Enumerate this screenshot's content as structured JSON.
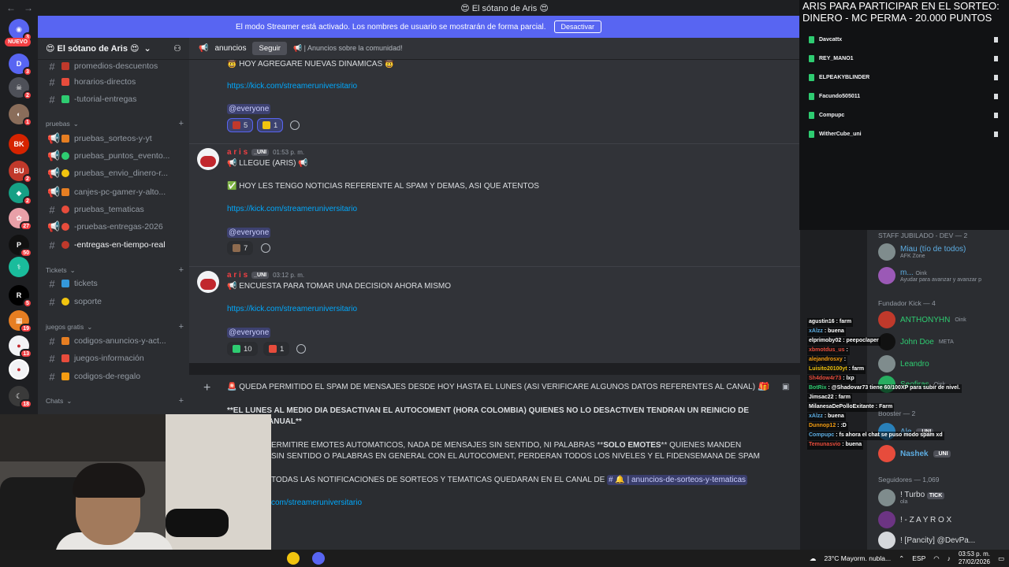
{
  "titlebar": {
    "title": "😍 El sótano de Aris 😍"
  },
  "rail": {
    "nuevo_label": "NUEVO",
    "badges": [
      "3",
      "3",
      "2",
      "1",
      "2",
      "2",
      "27",
      "50",
      "5",
      "19",
      "13",
      "18"
    ]
  },
  "banner": {
    "text": "El modo Streamer está activado. Los nombres de usuario se mostrarán de forma parcial.",
    "button": "Desactivar"
  },
  "sidebar": {
    "guild_name": "😍 El sótano de Aris 😍",
    "channels": [
      {
        "label": "promedios-descuentos"
      },
      {
        "label": "horarios-directos"
      },
      {
        "label": "-tutorial-entregas"
      }
    ],
    "categories": {
      "pruebas": "pruebas",
      "tickets": "Tickets",
      "juegos": "juegos gratis",
      "chats": "Chats"
    },
    "pruebas_channels": [
      {
        "label": "pruebas_sorteos-y-yt"
      },
      {
        "label": "pruebas_puntos_evento..."
      },
      {
        "label": "pruebas_envio_dinero-r..."
      },
      {
        "label": "canjes-pc-gamer-y-alto..."
      },
      {
        "label": "pruebas_tematicas"
      },
      {
        "label": "-pruebas-entregas-2026"
      },
      {
        "label": "-entregas-en-tiempo-real"
      }
    ],
    "tickets_channels": [
      {
        "label": "tickets"
      },
      {
        "label": "soporte"
      }
    ],
    "juegos_channels": [
      {
        "label": "codigos-anuncios-y-act..."
      },
      {
        "label": "juegos-información"
      },
      {
        "label": "codigos-de-regalo"
      }
    ],
    "chats_channel": "codigos-de-regalo"
  },
  "chathead": {
    "channel": "anuncios",
    "follow": "Seguir",
    "topic": "📢 | Anuncios sobre la comunidad!"
  },
  "messages": {
    "m0": {
      "line1": "HOY AGREGARE NUEVAS DINAMICAS",
      "link": "https://kick.com/streameruniversitario",
      "mention": "@everyone",
      "reactions": [
        {
          "count": "5"
        },
        {
          "count": "1"
        }
      ]
    },
    "m1": {
      "author": "a r i s",
      "tag": "_UNI",
      "time": "01:53 p. m.",
      "line1": "📢 LLEGUE (ARIS) 📢",
      "line2": "✅ HOY LES TENGO NOTICIAS REFERENTE AL SPAM Y DEMAS, ASI QUE ATENTOS",
      "link": "https://kick.com/streameruniversitario",
      "mention": "@everyone",
      "reactions": [
        {
          "count": "7"
        }
      ]
    },
    "m2": {
      "author": "a r i s",
      "tag": "_UNI",
      "time": "03:12 p. m.",
      "line1": "📢 ENCUESTA PARA TOMAR UNA DECISION AHORA MISMO",
      "link": "https://kick.com/streameruniversitario",
      "mention": "@everyone",
      "reactions": [
        {
          "count": "10"
        },
        {
          "count": "1"
        }
      ]
    }
  },
  "composer": {
    "line1": "QUEDA PERMITIDO EL SPAM DE MENSAJES DESDE HOY HASTA EL LUNES (ASI VERIFICARE ALGUNOS DATOS REFERENTES AL CANAL)",
    "line2": "**EL LUNES AL MEDIO DIA DESACTIVAN EL AUTOCOMENT (HORA COLOMBIA) QUIENES NO LO DESACTIVEN TENDRAN UN REINICIO DE",
    "line3": "ANUAL**",
    "line4a": "ERMITIRE EMOTES AUTOMATICOS, NADA DE MENSAJES SIN SENTIDO, NI PALABRAS **",
    "line4b": "SOLO EMOTES",
    "line4c": "** QUIENES MANDEN",
    "line5": "SIN SENTIDO O PALABRAS EN GENERAL CON EL AUTOCOMENT, PERDERAN TODOS LOS NIVELES Y EL FIDENSEMANA DE SPAM",
    "line6": "TODAS LAS NOTIFICACIONES DE SORTEOS Y TEMATICAS QUEDARAN EN EL CANAL DE",
    "line6_channel": "anuncios-de-sorteos-y-tematicas",
    "line7": "com/streameruniversitario"
  },
  "overlay": {
    "title1": "ARIS PARA PARTICIPAR EN EL SORTEO:",
    "title2": "DINERO - MC PERMA - 20.000 PUNTOS",
    "rows": [
      "Davcattx",
      "REY_MANO1",
      "ELPEAKYBLINDER",
      "Facundo505011",
      "Compupc",
      "WitherCube_uni"
    ]
  },
  "members": {
    "staff_header": "STAFF JUBILADO - DEV — 2",
    "staff": [
      {
        "name": "Miau (tío de todos)",
        "sub": "AFK Zone"
      },
      {
        "name": "m...",
        "sub": "Ayudar para avanzar y avanzar p",
        "tag": "Oink"
      }
    ],
    "fundador_header": "Fundador Kick — 4",
    "fundador": [
      {
        "name": "ANTHONYHN",
        "tag": "Oink"
      },
      {
        "name": "John Doe",
        "tag": "META"
      },
      {
        "name": "Leandro"
      },
      {
        "name": "Seofiras",
        "tag": "Oink"
      }
    ],
    "booster_header": "Booster — 2",
    "booster": [
      {
        "name": "Ale",
        "tag": "_UNI"
      },
      {
        "name": "Nashek",
        "tag": "_UNI"
      }
    ],
    "seguidores_header": "Seguidores — 1,069",
    "seguidores": [
      {
        "name": "! Turbo",
        "tag": "TICK",
        "sub": "ola"
      },
      {
        "name": "! - Z A Y R O X"
      },
      {
        "name": "! [Pancity] @DevPa..."
      }
    ]
  },
  "stream_chat": [
    {
      "user": "agustin16",
      "msg": "farm"
    },
    {
      "user": "xAlzz",
      "msg": "buena"
    },
    {
      "user": "elprimoby02",
      "msg": "peepoclaper"
    },
    {
      "user": "xbmotdus_us",
      "msg": ""
    },
    {
      "user": "alejandrosxy",
      "msg": ""
    },
    {
      "user": "Luisito20100yt",
      "msg": "farm"
    },
    {
      "user": "Sh4dow4r73",
      "msg": "lxp"
    },
    {
      "user": "BotRix",
      "msg": "@Shadovar73 tiene 60/100XP para subir de nivel."
    },
    {
      "user": "Jimsac22",
      "msg": "farm"
    },
    {
      "user": "MilanesaDePolloExitante",
      "msg": "Farm"
    },
    {
      "user": "xAlzz",
      "msg": "buena"
    },
    {
      "user": "Dunnop12",
      "msg": ":D"
    },
    {
      "user": "Compupc",
      "msg": "fs ahora el chat se puso modo spam xd"
    },
    {
      "user": "Temunasvio",
      "msg": "buena"
    }
  ],
  "taskbar": {
    "weather": "23°C  Mayorm. nubla...",
    "lang": "ESP",
    "time": "03:53 p. m.",
    "date": "27/02/2026"
  }
}
